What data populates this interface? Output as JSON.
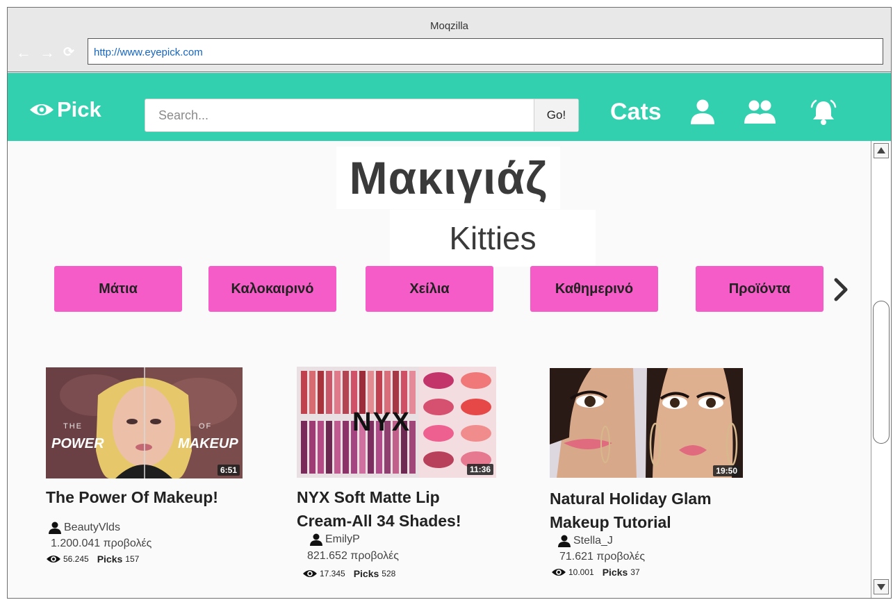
{
  "browser": {
    "window_title": "Moqzilla",
    "url": "http://www.eyepick.com",
    "back_glyph": "←",
    "forward_glyph": "→",
    "reload_glyph": "⟳"
  },
  "appbar": {
    "logo_text": "Pick",
    "search_placeholder": "Search...",
    "go_label": "Go!",
    "cats_label": "Cats",
    "background_color": "#33d0b0",
    "icons": [
      "eye-icon",
      "user-icon",
      "group-icon",
      "bell-icon"
    ]
  },
  "page": {
    "title": "Μακιγιάζ",
    "subtitle": "Kitties"
  },
  "categories": {
    "accent_color": "#f55cc7",
    "items": [
      "Μάτια",
      "Καλοκαιρινό",
      "Χείλια",
      "Καθημερινό",
      "Προϊόντα"
    ]
  },
  "videos": [
    {
      "duration": "6:51",
      "title_lines": [
        "The Power Of Makeup!"
      ],
      "channel": "BeautyVlds",
      "views": "1.200.041 προβολές",
      "watch_count": "56.245",
      "picks_label": "Picks",
      "picks_count": "157"
    },
    {
      "duration": "11:36",
      "title_lines": [
        "NYX Soft Matte Lip",
        "Cream-All 34 Shades!"
      ],
      "channel": "EmilyP",
      "views": "821.652 προβολές",
      "watch_count": "17.345",
      "picks_label": "Picks",
      "picks_count": "528"
    },
    {
      "duration": "19:50",
      "title_lines": [
        "Natural Holiday Glam",
        "Makeup Tutorial"
      ],
      "channel": "Stella_J",
      "views": "71.621 προβολές",
      "watch_count": "10.001",
      "picks_label": "Picks",
      "picks_count": "37"
    }
  ]
}
